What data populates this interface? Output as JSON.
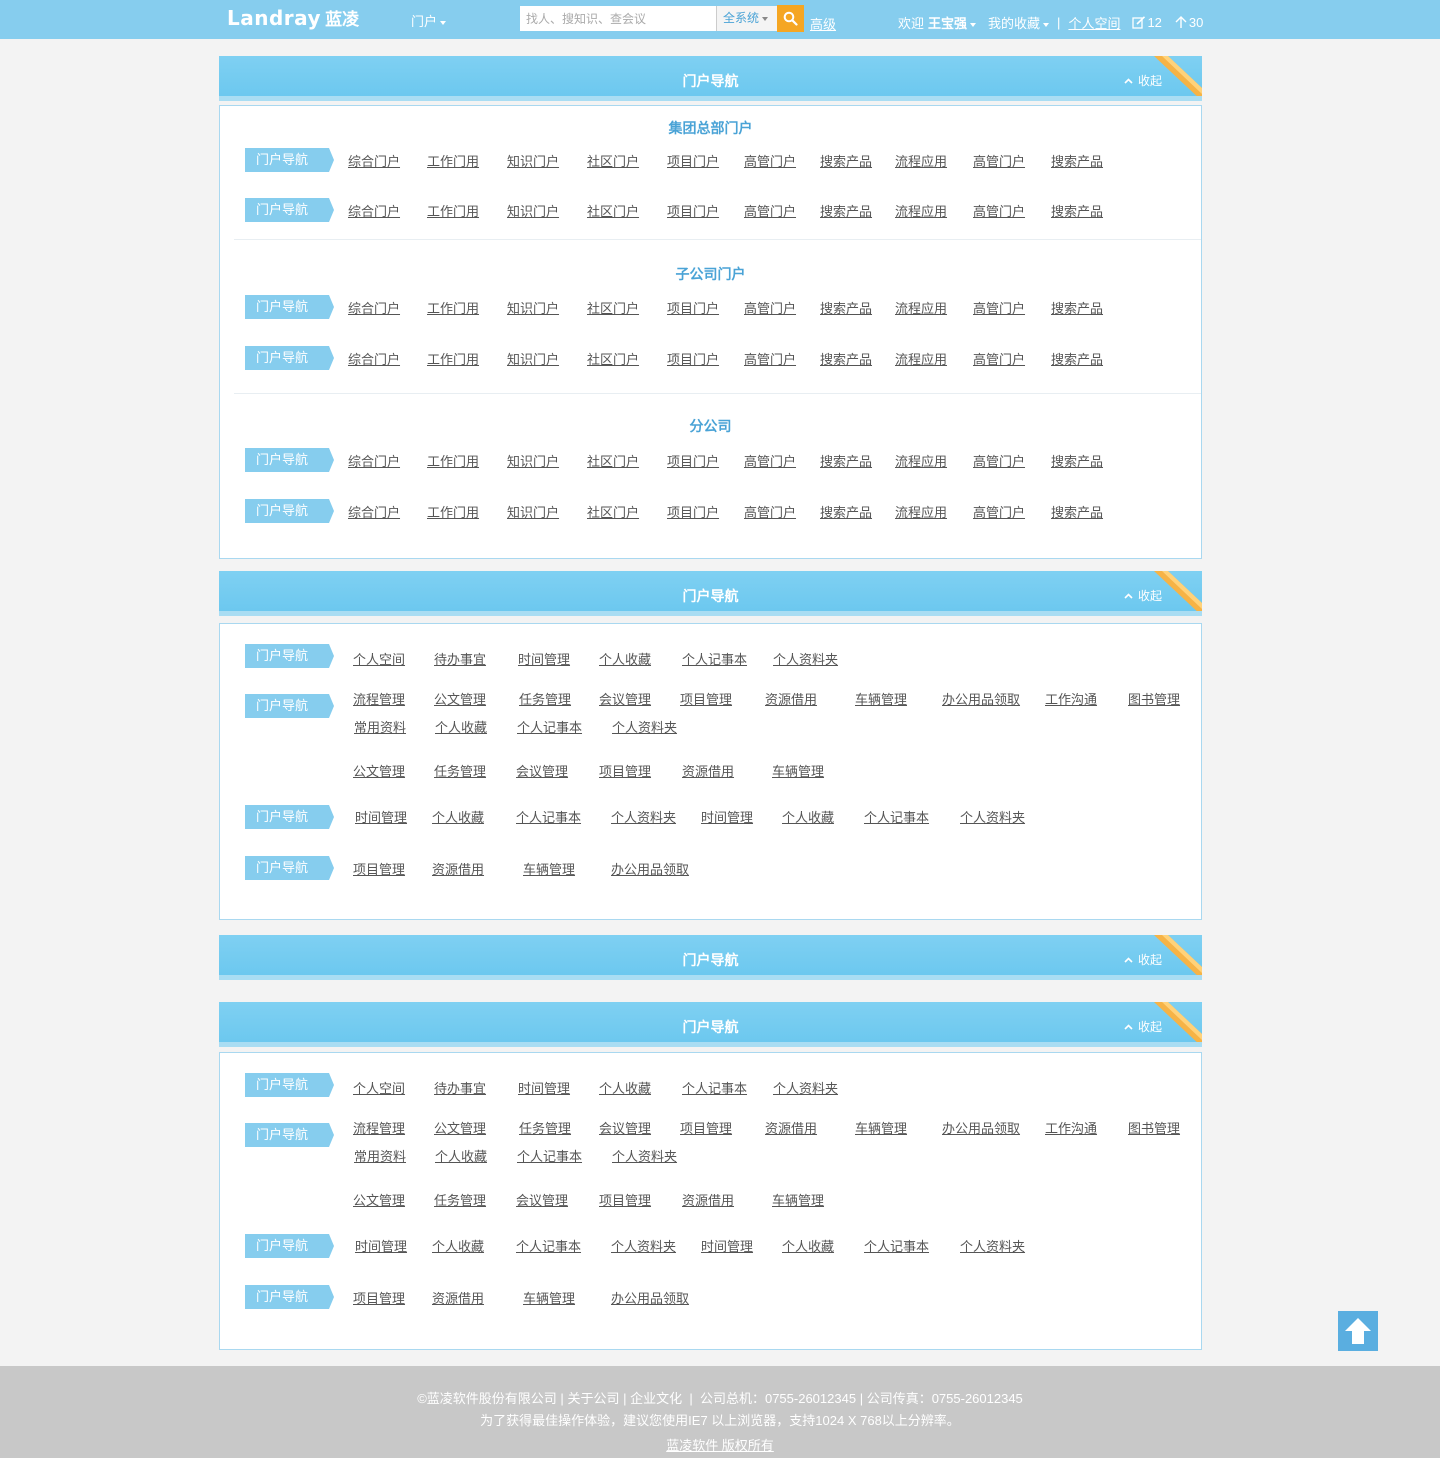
{
  "header": {
    "logo_en": "Landray",
    "logo_cn": "蓝凌",
    "portal_menu": "门户",
    "search_placeholder": "找人、搜知识、查会议",
    "search_scope": "全系统",
    "advanced": "高级",
    "welcome": "欢迎",
    "user_name": "王宝强",
    "favorites": "我的收藏",
    "separator": "|",
    "personal_space": "个人空间",
    "notes_count": "12",
    "todo_count": "30"
  },
  "sections": [
    {
      "title": "门户导航",
      "collapse": "收起"
    },
    {
      "title": "门户导航",
      "collapse": "收起"
    },
    {
      "title": "门户导航",
      "collapse": "收起"
    },
    {
      "title": "门户导航",
      "collapse": "收起"
    }
  ],
  "portal_panel": {
    "tag": "门户导航",
    "groups": [
      {
        "title": "集团总部门户",
        "links": [
          "综合门户",
          "工作门用",
          "知识门户",
          "社区门户",
          "项目门户",
          "高管门户",
          "搜索产品",
          "流程应用",
          "高管门户",
          "搜索产品"
        ]
      },
      {
        "title": "子公司门户",
        "links": [
          "综合门户",
          "工作门用",
          "知识门户",
          "社区门户",
          "项目门户",
          "高管门户",
          "搜索产品",
          "流程应用",
          "高管门户",
          "搜索产品"
        ]
      },
      {
        "title": "分公司",
        "links": [
          "综合门户",
          "工作门用",
          "知识门户",
          "社区门户",
          "项目门户",
          "高管门户",
          "搜索产品",
          "流程应用",
          "高管门户",
          "搜索产品"
        ]
      }
    ]
  },
  "app_panel": {
    "tag": "门户导航",
    "row1": [
      "个人空间",
      "待办事宜",
      "时间管理",
      "个人收藏",
      "个人记事本",
      "个人资料夹"
    ],
    "row2": [
      "流程管理",
      "公文管理",
      "任务管理",
      "会议管理",
      "项目管理",
      "资源借用",
      "车辆管理",
      "办公用品领取",
      "工作沟通",
      "图书管理"
    ],
    "row2b": [
      "常用资料",
      "个人收藏",
      "个人记事本",
      "个人资料夹"
    ],
    "row3": [
      "公文管理",
      "任务管理",
      "会议管理",
      "项目管理",
      "资源借用",
      "车辆管理"
    ],
    "row4": [
      "时间管理",
      "个人收藏",
      "个人记事本",
      "个人资料夹",
      "时间管理",
      "个人收藏",
      "个人记事本",
      "个人资料夹"
    ],
    "row5": [
      "项目管理",
      "资源借用",
      "车辆管理",
      "办公用品领取"
    ]
  },
  "footer": {
    "copyright": "©蓝凌软件股份有限公司",
    "about": "关于公司",
    "culture": "企业文化",
    "phone": "公司总机：0755-26012345",
    "fax": "公司传真：0755-26012345",
    "sep": "|",
    "notice": "为了获得最佳操作体验，建议您使用IE7 以上浏览器，支持1024 X 768以上分辨率。",
    "rights": "蓝凌软件 版权所有"
  },
  "colors": {
    "topbar": "#86cdee",
    "accent": "#4aa3d6",
    "search_button": "#f5a623",
    "ribbon": "#f6b346"
  },
  "icons": [
    "search-icon",
    "edit-icon",
    "upload-icon",
    "chevron-up-icon",
    "arrow-up-icon",
    "caret-down-icon"
  ]
}
